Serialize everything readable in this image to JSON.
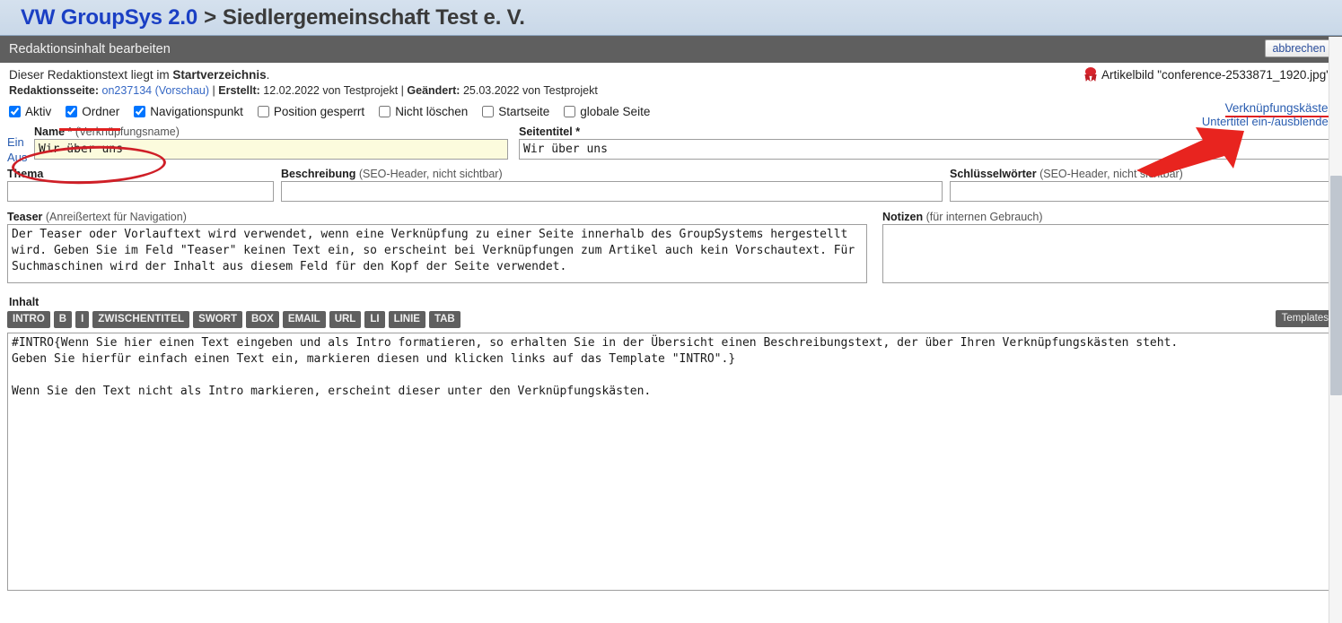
{
  "brand": {
    "app": "VW GroupSys 2.0",
    "separator": ">",
    "org": "Siedlergemeinschaft Test e. V."
  },
  "titlestrip": {
    "title": "Redaktionsinhalt bearbeiten",
    "cancel_label": "abbrechen"
  },
  "info": {
    "line1_prefix": "Dieser Redaktionstext liegt im ",
    "line1_bold": "Startverzeichnis",
    "line1_suffix": ".",
    "meta_label_page": "Redaktionsseite:",
    "meta_page_link": "on237134 (Vorschau)",
    "sep1": "|",
    "meta_label_created": "Erstellt:",
    "meta_created": "12.02.2022 von Testprojekt",
    "sep2": "|",
    "meta_label_changed": "Geändert:",
    "meta_changed": "25.03.2022 von Testprojekt",
    "artikelbild": "Artikelbild \"conference-2533871_1920.jpg\""
  },
  "checkboxes": [
    {
      "label": "Aktiv",
      "checked": true,
      "annotated": false
    },
    {
      "label": "Ordner",
      "checked": true,
      "annotated": true
    },
    {
      "label": "Navigationspunkt",
      "checked": true,
      "annotated": false
    },
    {
      "label": "Position gesperrt",
      "checked": false,
      "annotated": false
    },
    {
      "label": "Nicht löschen",
      "checked": false,
      "annotated": false
    },
    {
      "label": "Startseite",
      "checked": false,
      "annotated": false
    },
    {
      "label": "globale Seite",
      "checked": false,
      "annotated": false
    }
  ],
  "links": {
    "verknuepfungskaesten": "Verknüpfungskästen",
    "untertitel_toggle": "Untertitel ein-/ausblenden",
    "ein": "Ein",
    "aus": "Aus"
  },
  "fields": {
    "name": {
      "label_bold": "Name *",
      "label_dim": "(Verknüpfungsname)",
      "value": "Wir über uns"
    },
    "seitentitel": {
      "label_bold": "Seitentitel *",
      "label_dim": "",
      "value": "Wir über uns"
    },
    "thema": {
      "label_bold": "Thema",
      "label_dim": "",
      "value": ""
    },
    "beschreibung": {
      "label_bold": "Beschreibung",
      "label_dim": "(SEO-Header, nicht sichtbar)",
      "value": ""
    },
    "schluesselwoerter": {
      "label_bold": "Schlüsselwörter",
      "label_dim": "(SEO-Header, nicht sichtbar)",
      "value": ""
    },
    "teaser": {
      "label_bold": "Teaser",
      "label_dim": "(Anreißertext für Navigation)",
      "value": "Der Teaser oder Vorlauftext wird verwendet, wenn eine Verknüpfung zu einer Seite innerhalb des GroupSystems hergestellt wird. Geben Sie im Feld \"Teaser\" keinen Text ein, so erscheint bei Verknüpfungen zum Artikel auch kein Vorschautext. Für Suchmaschinen wird der Inhalt aus diesem Feld für den Kopf der Seite verwendet."
    },
    "notizen": {
      "label_bold": "Notizen",
      "label_dim": "(für internen Gebrauch)",
      "value": ""
    },
    "inhalt": {
      "label_bold": "Inhalt",
      "value": "#INTRO{Wenn Sie hier einen Text eingeben und als Intro formatieren, so erhalten Sie in der Übersicht einen Beschreibungstext, der über Ihren Verknüpfungskästen steht.\nGeben Sie hierfür einfach einen Text ein, markieren diesen und klicken links auf das Template \"INTRO\".}\n\nWenn Sie den Text nicht als Intro markieren, erscheint dieser unter den Verknüpfungskästen."
    }
  },
  "toolbar": {
    "buttons": [
      "INTRO",
      "B",
      "I",
      "ZWISCHENTITEL",
      "SWORT",
      "BOX",
      "EMAIL",
      "URL",
      "LI",
      "LINIE",
      "TAB"
    ],
    "templates_label": "Templates"
  },
  "colors": {
    "brand_blue": "#1a3fc4",
    "header_bg": "#cfdceb",
    "strip_gray": "#5f5f5f",
    "link_blue": "#2a5db0",
    "annotation_red": "#d8242c",
    "highlight_yellow": "#fcfbdd"
  }
}
